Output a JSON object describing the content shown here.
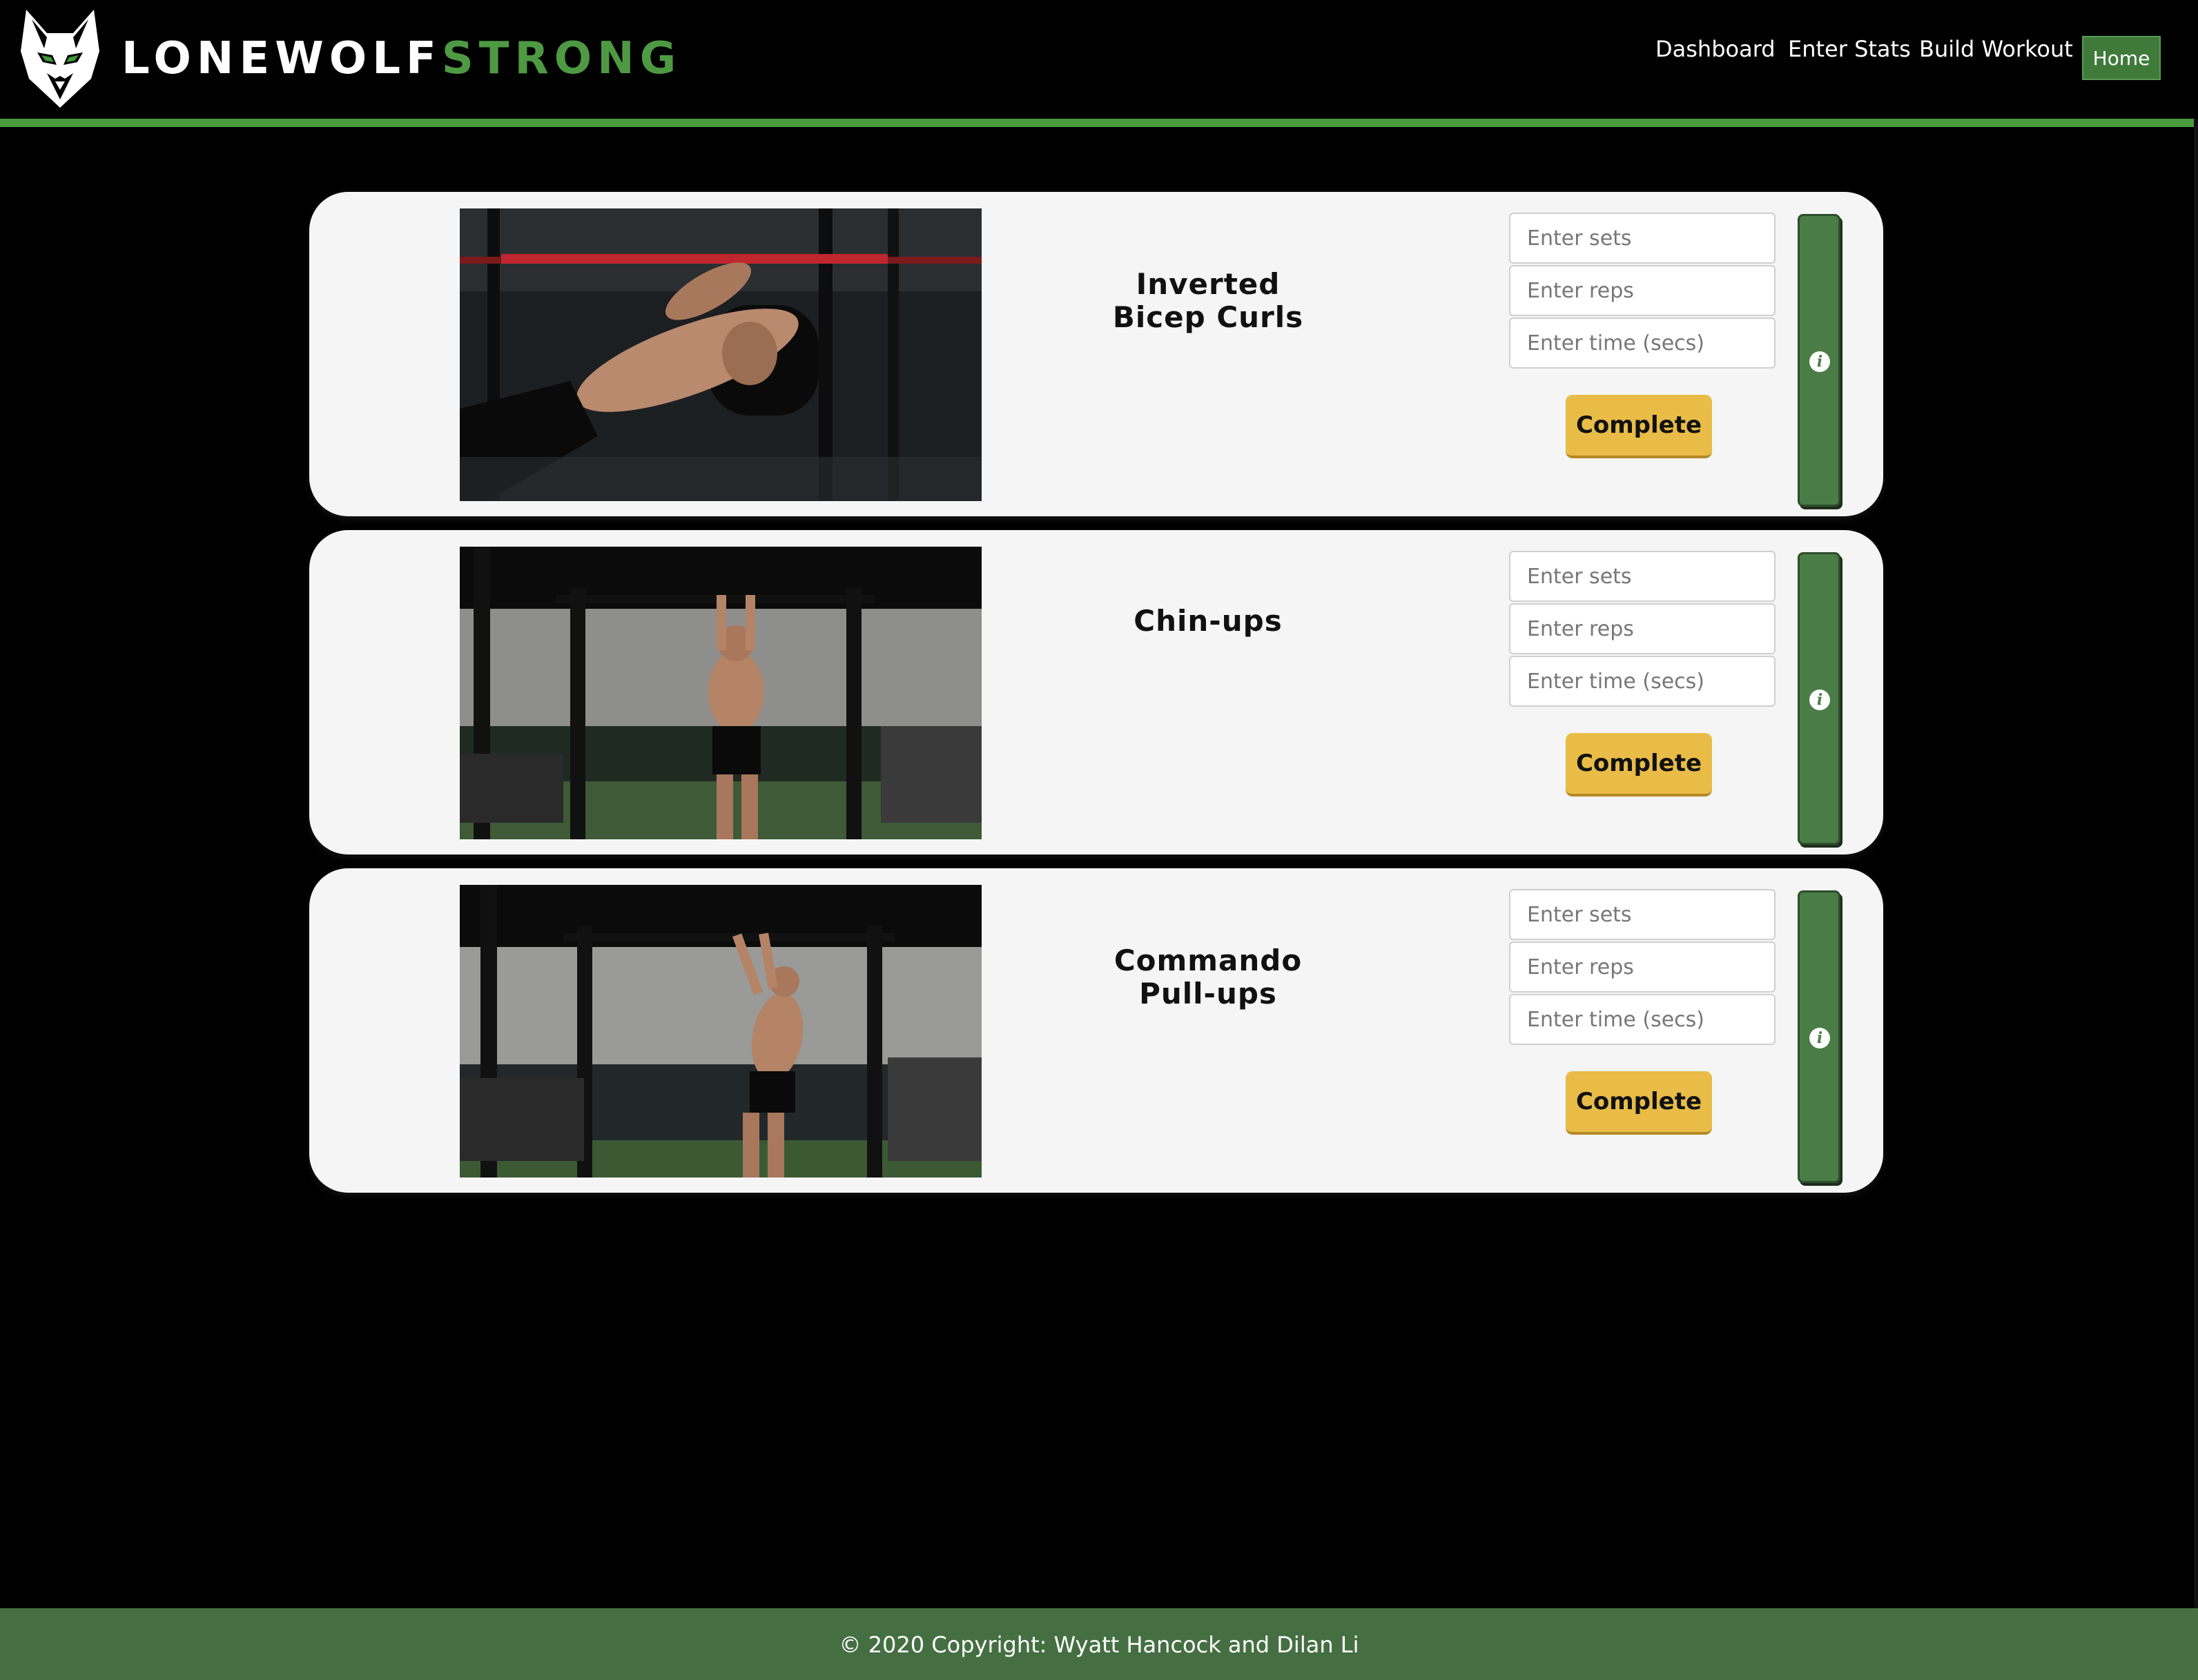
{
  "brand": {
    "name_part1": "LONEWOLF",
    "name_part2": "STRONG",
    "accent_color": "#4e9a43"
  },
  "nav": {
    "items": [
      {
        "label": "Dashboard"
      },
      {
        "label": "Enter Stats"
      },
      {
        "label": "Build Workout"
      }
    ],
    "home_label": "Home"
  },
  "exercises": [
    {
      "title_line1": "Inverted",
      "title_line2": "Bicep Curls",
      "sets_placeholder": "Enter sets",
      "reps_placeholder": "Enter reps",
      "time_placeholder": "Enter time (secs)",
      "complete_label": "Complete",
      "info_icon": "info-icon"
    },
    {
      "title_line1": "Chin-ups",
      "title_line2": "",
      "sets_placeholder": "Enter sets",
      "reps_placeholder": "Enter reps",
      "time_placeholder": "Enter time (secs)",
      "complete_label": "Complete",
      "info_icon": "info-icon"
    },
    {
      "title_line1": "Commando",
      "title_line2": "Pull-ups",
      "sets_placeholder": "Enter sets",
      "reps_placeholder": "Enter reps",
      "time_placeholder": "Enter time (secs)",
      "complete_label": "Complete",
      "info_icon": "info-icon"
    }
  ],
  "footer": {
    "text": "© 2020 Copyright: Wyatt Hancock and Dilan Li"
  },
  "colors": {
    "nav_border": "#4a9a3f",
    "complete_button": "#e8bc47",
    "info_bar": "#4a7c47",
    "footer_bg": "#456f42"
  }
}
